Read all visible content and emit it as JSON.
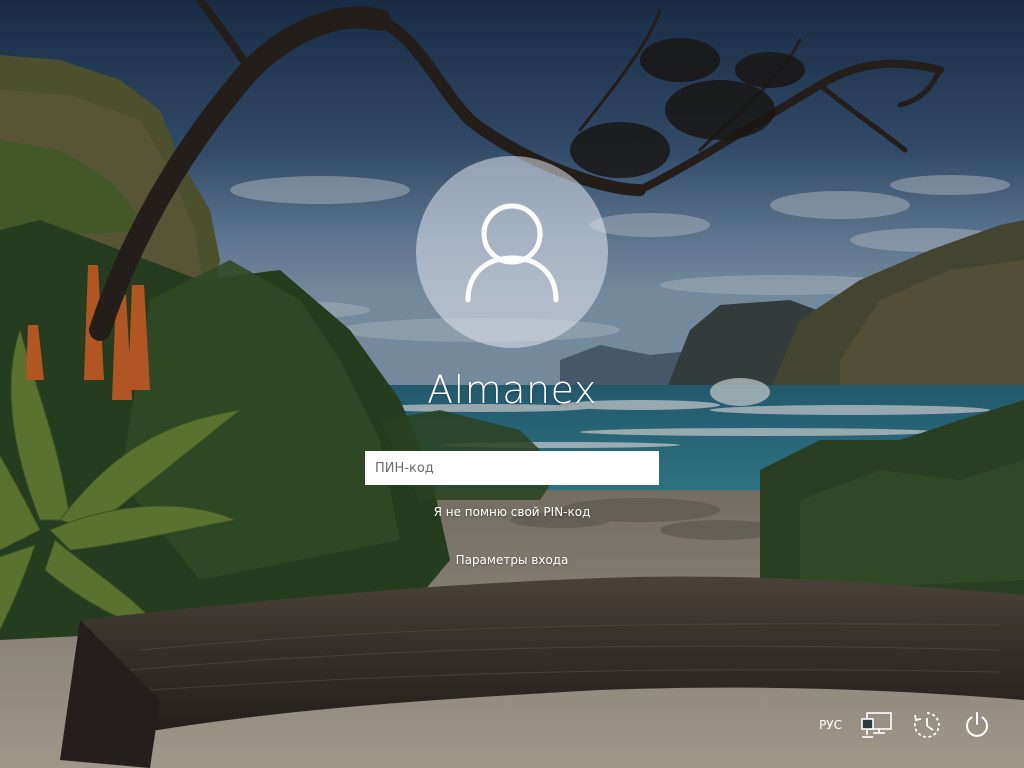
{
  "user": {
    "name": "Almanex",
    "avatar_icon": "user-avatar-icon"
  },
  "pin": {
    "placeholder": "ПИН-код",
    "value": ""
  },
  "links": {
    "forgot_pin": "Я не помню свой PIN-код",
    "sign_in_options": "Параметры входа"
  },
  "tray": {
    "language": "РУС",
    "network_icon": "network-icon",
    "accessibility_icon": "accessibility-icon",
    "power_icon": "power-icon"
  },
  "colors": {
    "text": "#ffffff",
    "input_background": "#ffffff",
    "avatar_background": "#dde3ea"
  }
}
